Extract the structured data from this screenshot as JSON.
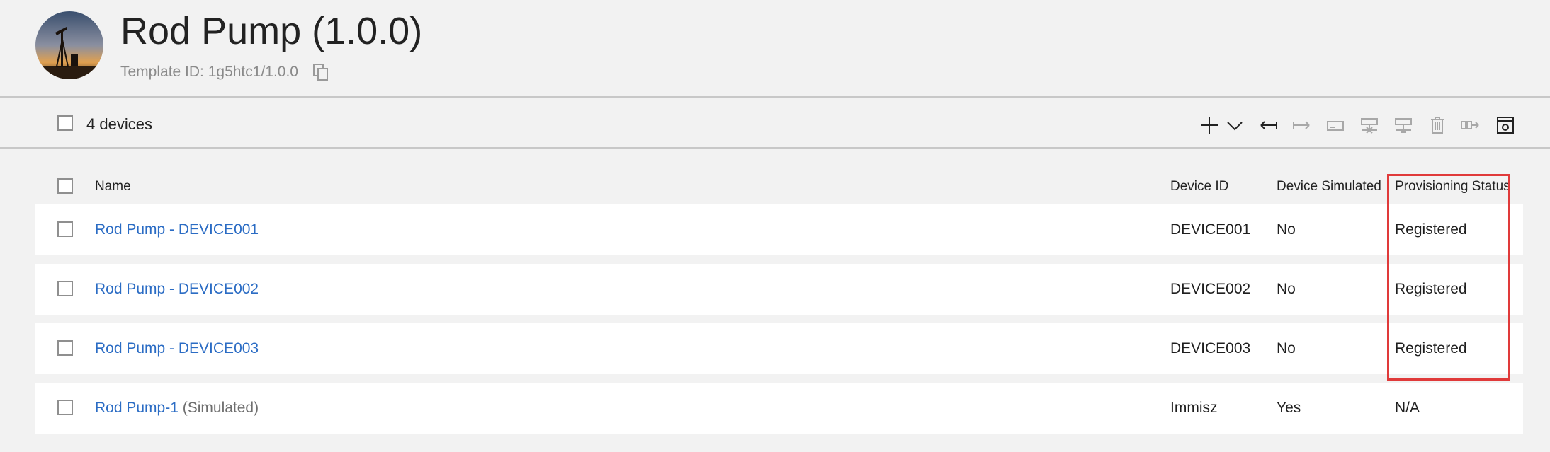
{
  "header": {
    "title": "Rod Pump (1.0.0)",
    "template_id": "Template ID: 1g5htc1/1.0.0"
  },
  "toolbar": {
    "devices_count": "4 devices"
  },
  "table": {
    "columns": {
      "name": "Name",
      "device_id": "Device ID",
      "simulated": "Device Simulated",
      "provisioning": "Provisioning Status"
    },
    "rows": [
      {
        "name": "Rod Pump - DEVICE001",
        "suffix": "",
        "device_id": "DEVICE001",
        "simulated": "No",
        "status": "Registered"
      },
      {
        "name": "Rod Pump - DEVICE002",
        "suffix": "",
        "device_id": "DEVICE002",
        "simulated": "No",
        "status": "Registered"
      },
      {
        "name": "Rod Pump - DEVICE003",
        "suffix": "",
        "device_id": "DEVICE003",
        "simulated": "No",
        "status": "Registered"
      },
      {
        "name": "Rod Pump-1",
        "suffix": "(Simulated)",
        "device_id": "Immisz",
        "simulated": "Yes",
        "status": "N/A"
      }
    ]
  },
  "colors": {
    "link": "#2b6cc4",
    "highlight": "#e03a3a",
    "background": "#f2f2f2"
  },
  "icons": [
    "copy-icon",
    "plus-icon",
    "chevron-down-icon",
    "collapse-left-icon",
    "expand-right-icon",
    "device-icon",
    "disconnect-icon",
    "connect-icon",
    "delete-icon",
    "migrate-icon",
    "settings-icon"
  ]
}
